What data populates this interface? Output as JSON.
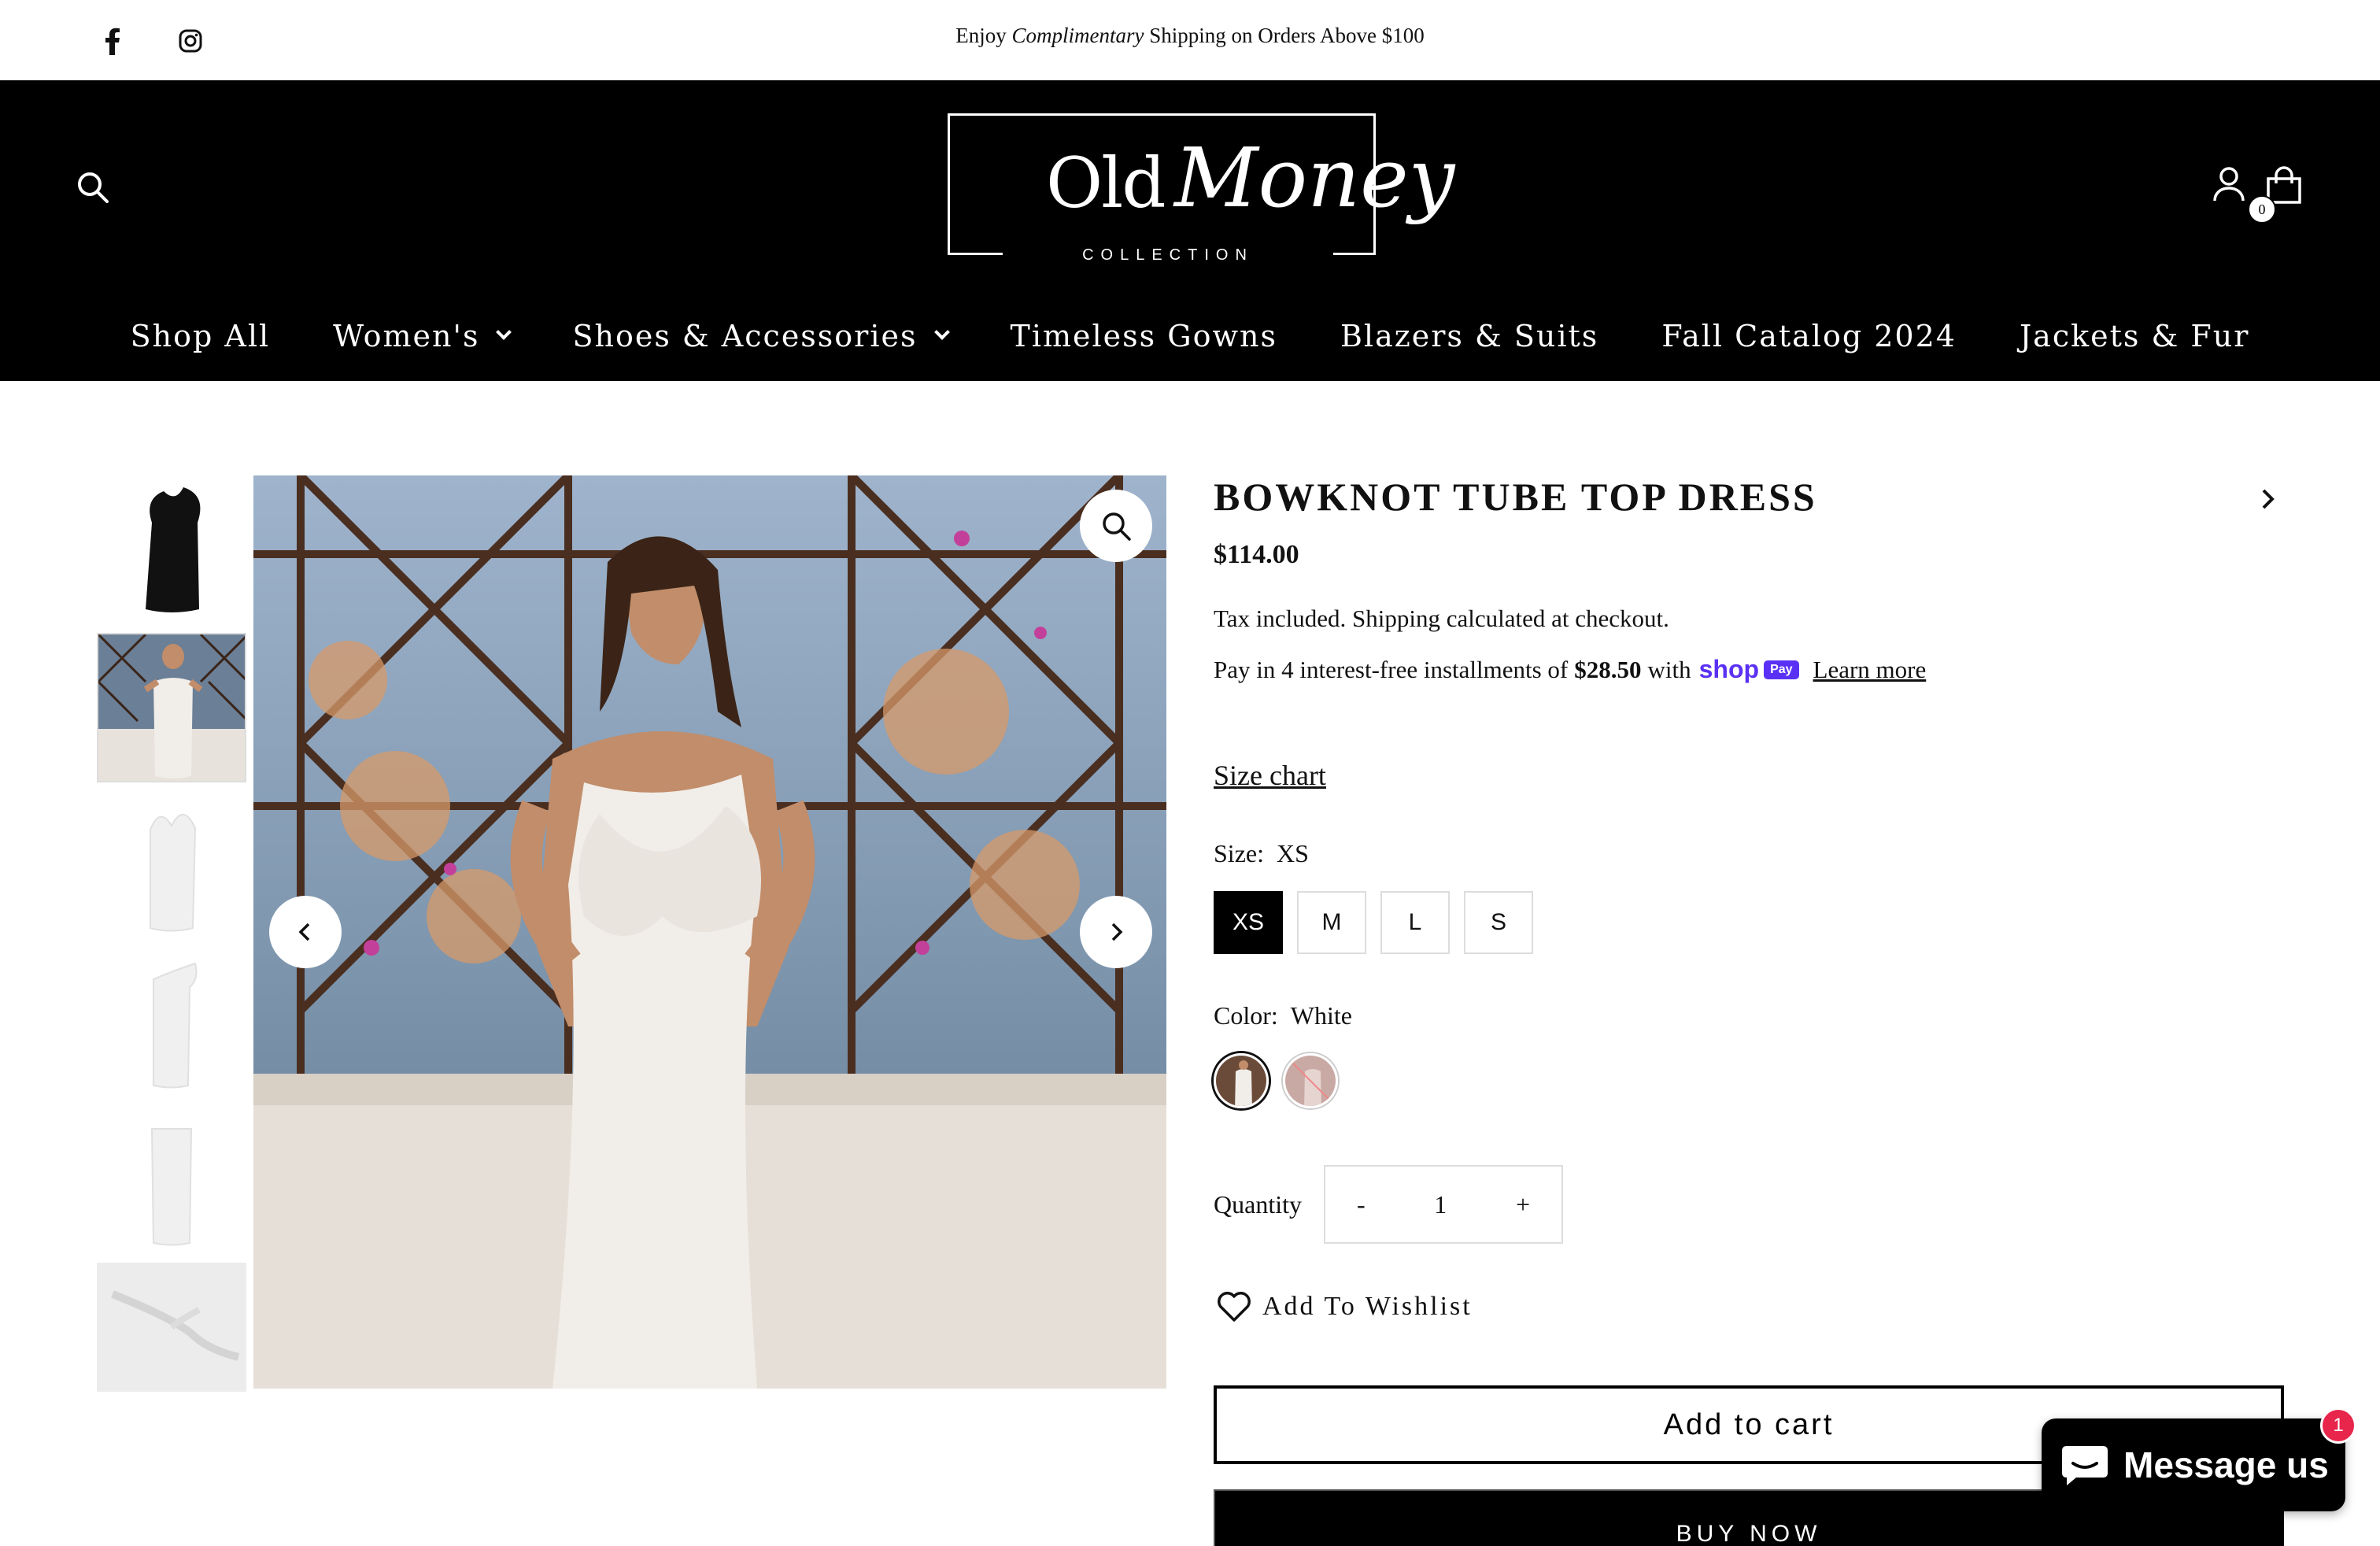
{
  "announcement": {
    "prefix": "Enjoy ",
    "emphasis": "Complimentary",
    "suffix": " Shipping on Orders Above $100",
    "social_icons": [
      "facebook-icon",
      "instagram-icon"
    ]
  },
  "header": {
    "logo": {
      "word1": "Old",
      "word2": "Money",
      "tagline": "COLLECTION"
    },
    "cart_count": "0",
    "icons": [
      "search-icon",
      "account-icon",
      "shopping-bag-icon"
    ]
  },
  "nav": {
    "items": [
      {
        "label": "Shop All",
        "dropdown": false
      },
      {
        "label": "Women's",
        "dropdown": true
      },
      {
        "label": "Shoes & Accessories",
        "dropdown": true
      },
      {
        "label": "Timeless Gowns",
        "dropdown": false
      },
      {
        "label": "Blazers & Suits",
        "dropdown": false
      },
      {
        "label": "Fall Catalog 2024",
        "dropdown": false
      },
      {
        "label": "Jackets & Fur",
        "dropdown": false
      }
    ]
  },
  "gallery": {
    "thumbnail_count": 6,
    "active_thumbnail": 2
  },
  "product": {
    "title": "BOWKNOT TUBE TOP DRESS",
    "price": "$114.00",
    "tax_note": "Tax included. Shipping calculated at checkout.",
    "installments": {
      "prefix": "Pay in 4 interest-free installments of",
      "amount": "$28.50",
      "with": "with",
      "shop_logo": "shop",
      "pay_badge": "Pay",
      "learn_more": "Learn more"
    },
    "size_chart": "Size chart",
    "size": {
      "label": "Size:",
      "selected": "XS",
      "options": [
        "XS",
        "M",
        "L",
        "S"
      ]
    },
    "color": {
      "label": "Color:",
      "selected": "White",
      "swatch_count": 2
    },
    "quantity": {
      "label": "Quantity",
      "minus": "-",
      "value": "1",
      "plus": "+"
    },
    "wishlist": "Add To Wishlist",
    "add_to_cart": "Add to cart",
    "buy_now": "BUY NOW"
  },
  "chat": {
    "label": "Message us",
    "badge": "1"
  },
  "colors": {
    "header_bg": "#000000",
    "shop_purple": "#5a31f4",
    "chat_badge": "#e8254b"
  }
}
